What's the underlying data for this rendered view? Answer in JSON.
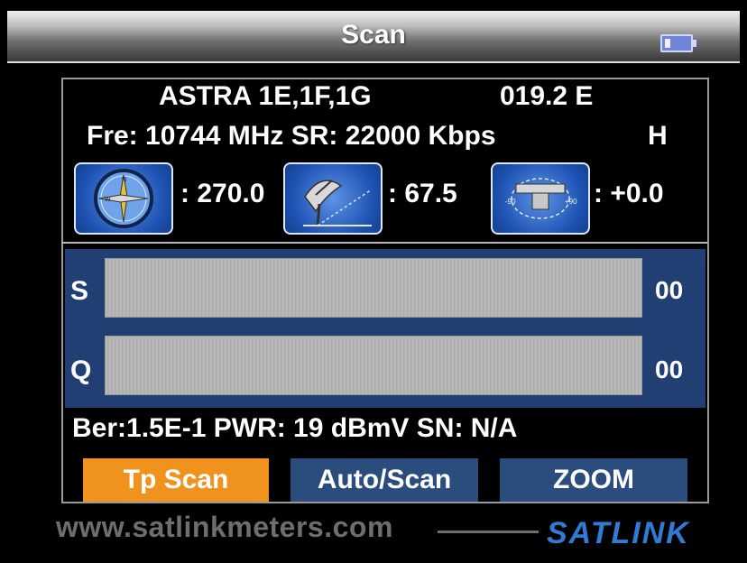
{
  "header": {
    "title": "Scan",
    "battery_icon": "battery-icon"
  },
  "satellite": {
    "name": "ASTRA 1E,1F,1G",
    "orbit": "019.2 E"
  },
  "tp": {
    "line": "Fre: 10744 MHz  SR: 22000 Kbps",
    "polarization": "H"
  },
  "angles": {
    "azimuth": {
      "icon": "compass-icon",
      "value": ": 270.0"
    },
    "elevation": {
      "icon": "dish-elevation-icon",
      "value": ": 67.5"
    },
    "skew": {
      "icon": "lnb-skew-icon",
      "value": ": +0.0"
    }
  },
  "meters": {
    "strength": {
      "label": "S",
      "value": "00",
      "level": 0
    },
    "quality": {
      "label": "Q",
      "value": "00",
      "level": 0
    }
  },
  "status": "Ber:1.5E-1  PWR: 19 dBmV   SN: N/A",
  "buttons": {
    "tp_scan": "Tp Scan",
    "auto_scan": "Auto/Scan",
    "zoom": "ZOOM"
  },
  "footer": {
    "url": "www.satlinkmeters.com",
    "brand": "SATLINK"
  },
  "colors": {
    "active_button": "#f0931e",
    "button": "#2a4d7e",
    "meter_panel": "#223f73"
  }
}
